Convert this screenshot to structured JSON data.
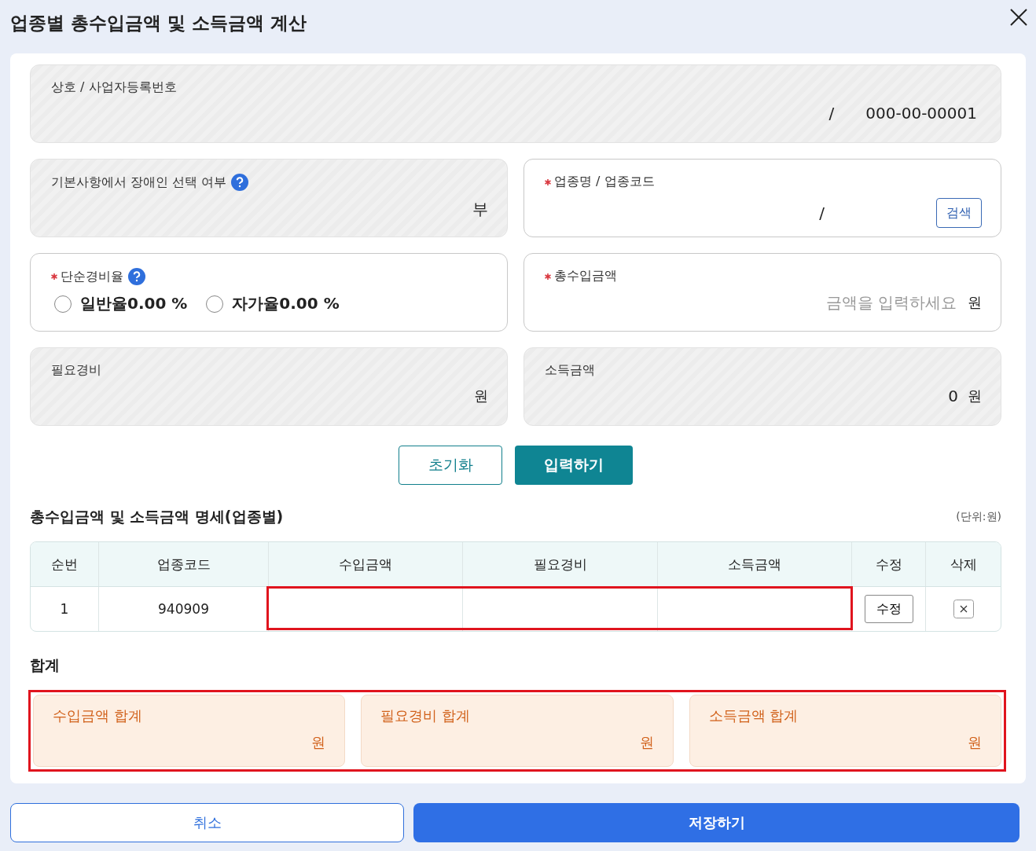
{
  "title": "업종별 총수입금액 및 소득금액 계산",
  "business": {
    "label": "상호 / 사업자등록번호",
    "readonly": true,
    "separator": "/",
    "value": "000-00-00001"
  },
  "disabled_check": {
    "label": "기본사항에서 장애인 선택 여부",
    "readonly": true,
    "value": "부"
  },
  "industry": {
    "label": "업종명 / 업종코드",
    "required": true,
    "readonly": false,
    "separator": "/",
    "search_button": "검색"
  },
  "rate": {
    "label": "단순경비율",
    "required": true,
    "readonly": false,
    "options": [
      {
        "label": "일반율0.00 %",
        "selected": false
      },
      {
        "label": "자가율0.00 %",
        "selected": false
      }
    ]
  },
  "total_income": {
    "label": "총수입금액",
    "required": true,
    "readonly": false,
    "placeholder": "금액을 입력하세요",
    "unit": "원"
  },
  "expenses": {
    "label": "필요경비",
    "readonly": true,
    "unit": "원"
  },
  "income": {
    "label": "소득금액",
    "readonly": true,
    "value": "0",
    "unit": "원"
  },
  "actions": {
    "reset": "초기화",
    "submit": "입력하기"
  },
  "table": {
    "title": "총수입금액 및 소득금액 명세(업종별)",
    "unit_note": "(단위:원)",
    "columns": [
      "순번",
      "업종코드",
      "수입금액",
      "필요경비",
      "소득금액",
      "수정",
      "삭제"
    ],
    "rows": [
      {
        "no": "1",
        "code": "940909",
        "edit_button": "수정"
      }
    ]
  },
  "totals": {
    "heading": "합계",
    "items": [
      {
        "label": "수입금액 합계",
        "unit": "원"
      },
      {
        "label": "필요경비 합계",
        "unit": "원"
      },
      {
        "label": "소득금액 합계",
        "unit": "원"
      }
    ]
  },
  "footer": {
    "cancel": "취소",
    "save": "저장하기"
  }
}
